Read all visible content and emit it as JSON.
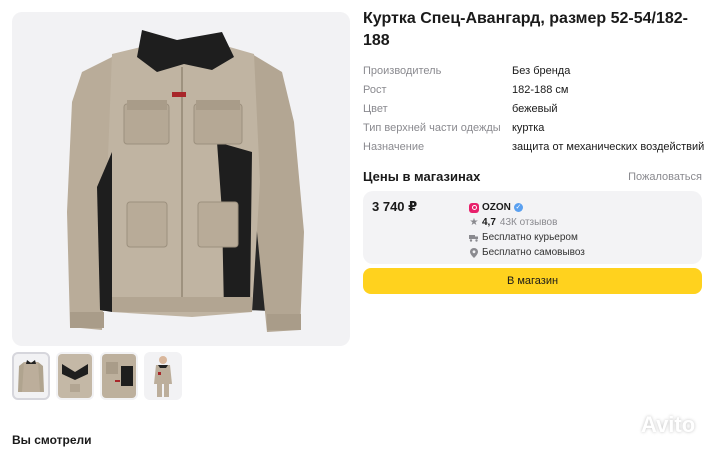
{
  "product": {
    "title": "Куртка Спец-Авангард, размер 52-54/182-188",
    "image_icon": "jacket-photo",
    "thumbnails": [
      {
        "icon": "jacket-front-thumb",
        "active": true
      },
      {
        "icon": "jacket-collar-thumb",
        "active": false
      },
      {
        "icon": "jacket-detail-thumb",
        "active": false
      },
      {
        "icon": "jacket-model-thumb",
        "active": false
      }
    ]
  },
  "specs": [
    {
      "key": "Производитель",
      "value": "Без бренда"
    },
    {
      "key": "Рост",
      "value": "182-188 см"
    },
    {
      "key": "Цвет",
      "value": "бежевый"
    },
    {
      "key": "Тип верхней части одежды",
      "value": "куртка"
    },
    {
      "key": "Назначение",
      "value": "защита от механических воздействий"
    }
  ],
  "prices": {
    "title": "Цены в магазинах",
    "sort_label": "Пожаловаться",
    "offer": {
      "price": "3 740 ₽",
      "shop": "OZON",
      "rating": "4,7",
      "reviews": "43К отзывов",
      "delivery": "Бесплатно курьером",
      "pickup": "Бесплатно самовывоз"
    },
    "button": "В магазин"
  },
  "seen": {
    "title": "Вы смотрели"
  },
  "watermark": {
    "text": "Avito"
  },
  "colors": {
    "accent_button": "#ffd21e",
    "ozon": "#e8206b",
    "jacket_beige": "#b8ab98",
    "jacket_black": "#1e1e1e"
  }
}
